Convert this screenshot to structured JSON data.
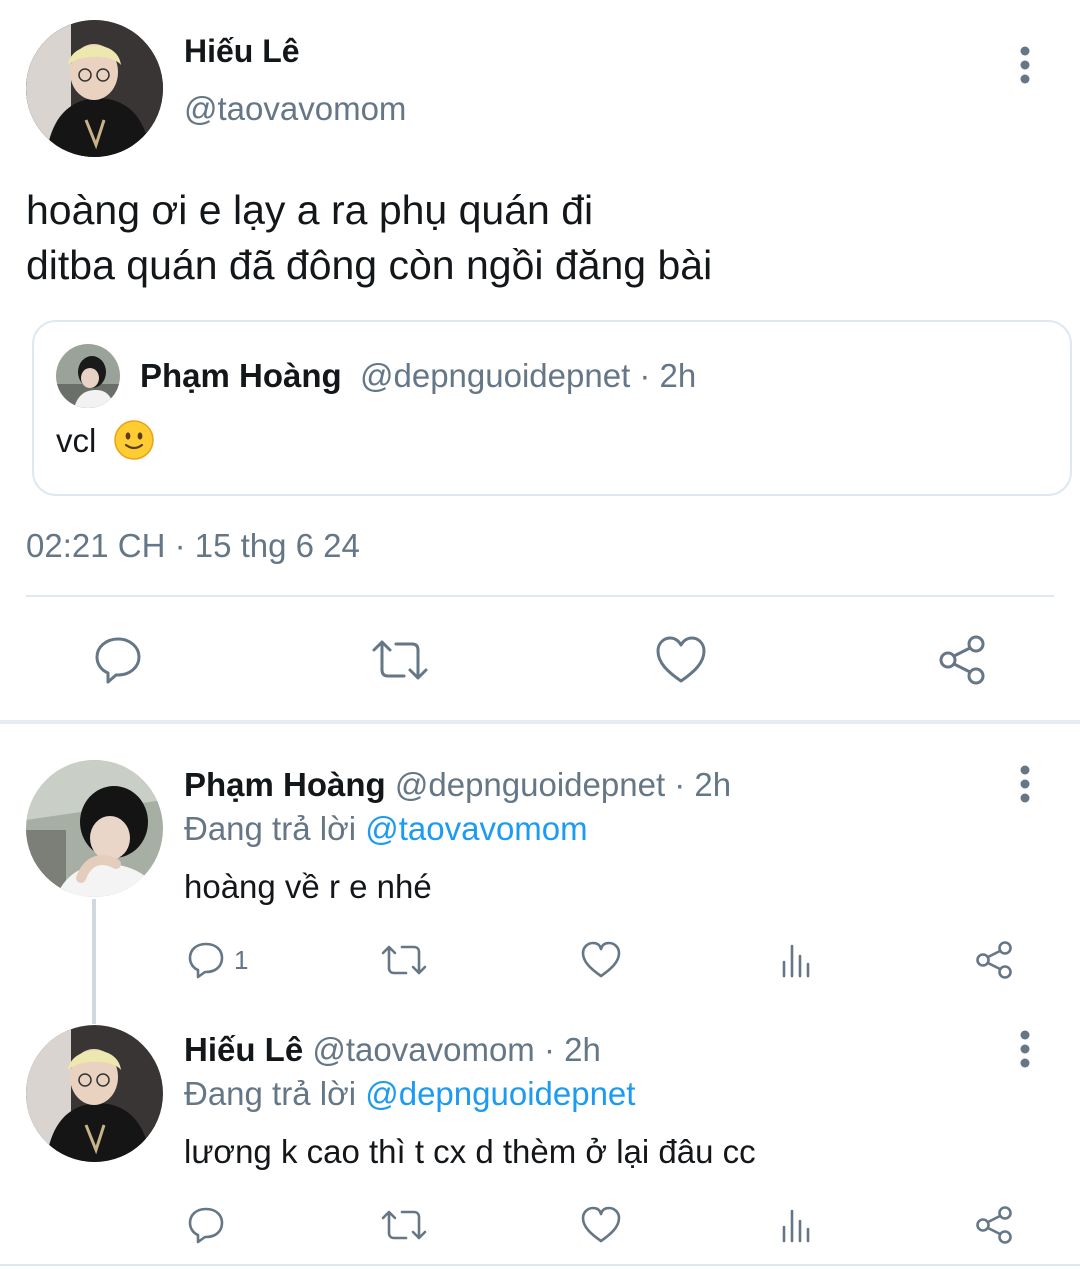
{
  "main_tweet": {
    "author_name": "Hiếu Lê",
    "author_handle": "@taovavomom",
    "text_line1": "hoàng ơi e lạy a ra phụ quán đi",
    "text_line2": "ditba quán đã đông còn ngồi đăng bài",
    "timestamp": "02:21 CH · 15 thg 6 24",
    "quoted": {
      "author_name": "Phạm Hoàng",
      "author_handle": "@depnguoidepnet · 2h",
      "text": "vcl",
      "emoji": "🙂"
    },
    "actions": [
      "reply-icon",
      "retweet-icon",
      "like-icon",
      "share-icon"
    ]
  },
  "replies": [
    {
      "author_name": "Phạm Hoàng",
      "author_handle_time": "@depnguoidepnet · 2h",
      "replying_prefix": "Đang trả lời",
      "replying_to": "@taovavomom",
      "text": "hoàng về r e nhé",
      "reply_count": "1"
    },
    {
      "author_name": "Hiếu Lê",
      "author_handle_time": "@taovavomom · 2h",
      "replying_prefix": "Đang trả lời",
      "replying_to": "@depnguoidepnet",
      "text": "lương k cao thì t cx d thèm ở lại đâu cc",
      "reply_count": ""
    }
  ],
  "colors": {
    "accent": "#1d9bf0",
    "secondary_text": "#657786",
    "divider": "#e1e8ed"
  }
}
